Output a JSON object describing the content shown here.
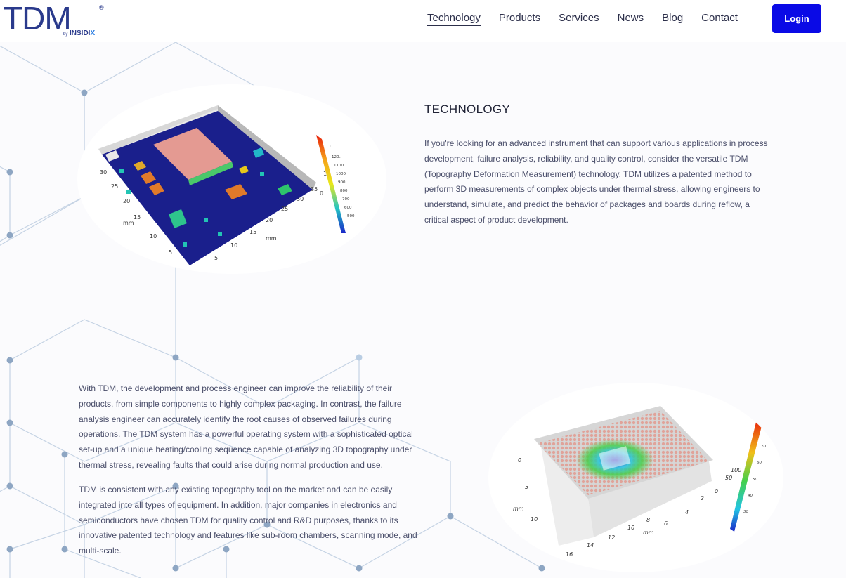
{
  "brand": {
    "logo_text": "TDM",
    "logo_reg": "®",
    "logo_by": "by",
    "logo_company": "INSIDI",
    "logo_company_x": "X",
    "color": "#2a3a8c"
  },
  "nav": {
    "items": [
      "Technology",
      "Products",
      "Services",
      "News",
      "Blog",
      "Contact"
    ],
    "active": "Technology",
    "login_label": "Login",
    "login_color": "#0a0ae6"
  },
  "section1": {
    "title": "TECHNOLOGY",
    "body": "If you're looking for an advanced instrument that can support various applications in process development, failure analysis, reliability, and quality control, consider the versatile TDM (Topography Deformation Measurement) technology. TDM utilizes a patented method to perform 3D measurements of complex objects under thermal stress, allowing engineers to understand, simulate, and predict the behavior of packages and boards during reflow, a critical aspect of product development."
  },
  "section2": {
    "body1": "With TDM, the development and process engineer can improve the reliability of their products, from simple components to highly complex packaging. In contrast, the failure analysis engineer can accurately identify the root causes of observed failures during operations. The TDM system has a powerful operating system with a sophisticated optical set-up and a unique heating/cooling sequence capable of analyzing 3D topography under thermal stress, revealing faults that could arise during normal production and use.",
    "body2": "TDM is consistent with any existing topography tool on the market and can be easily integrated into all types of equipment. In addition, major companies in electronics and semiconductors have chosen TDM for quality control and R&D purposes, thanks to its innovative patented technology and features like sub-room chambers, scanning mode, and multi-scale."
  },
  "figure1": {
    "x_ticks": [
      "5",
      "10",
      "15",
      "20",
      "25",
      "30"
    ],
    "y_ticks": [
      "5",
      "10",
      "15",
      "20",
      "25",
      "30",
      "35"
    ],
    "axis_label": "mm",
    "z_ticks": [
      "0",
      "1"
    ],
    "colorbar_ticks": [
      "1..",
      "120..",
      "1100",
      "1000",
      "900",
      "800",
      "700",
      "600",
      "500"
    ]
  },
  "figure2": {
    "x_ticks": [
      "0",
      "5",
      "10",
      "14",
      "16"
    ],
    "y_ticks": [
      "2",
      "4",
      "6",
      "8",
      "10",
      "12"
    ],
    "axis_label": "mm",
    "z_ticks": [
      "0",
      "50",
      "100"
    ],
    "colorbar_ticks": [
      "70",
      "60",
      "50",
      "40",
      "30"
    ]
  }
}
